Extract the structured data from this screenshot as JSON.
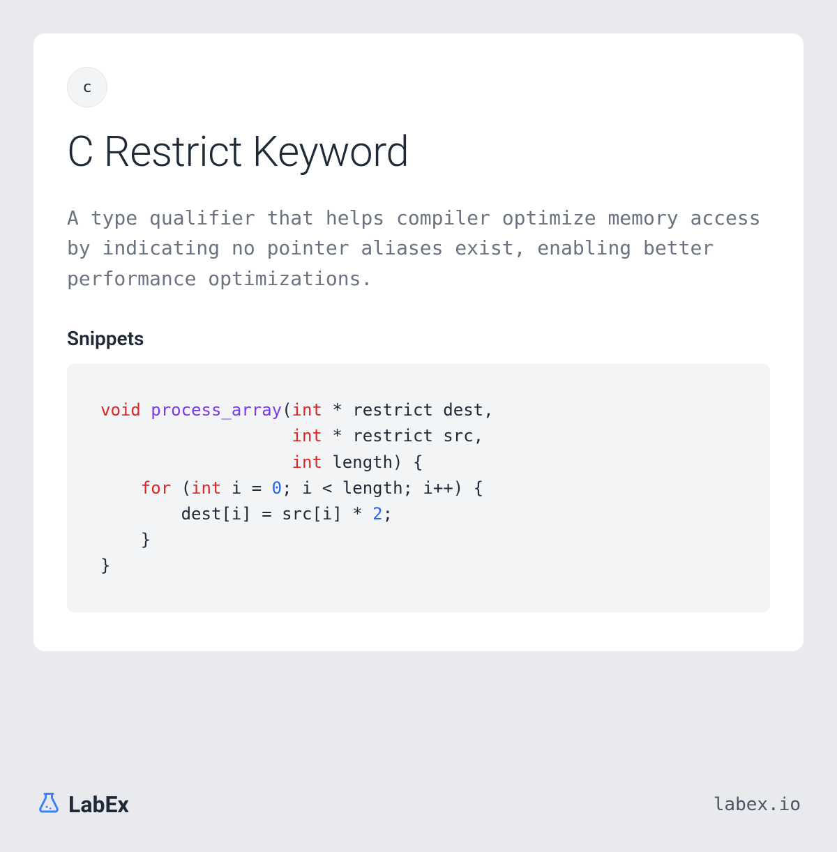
{
  "badge_letter": "c",
  "title": "C Restrict Keyword",
  "description": "A type qualifier that helps compiler optimize memory access by indicating no pointer aliases exist, enabling better performance optimizations.",
  "snippets_heading": "Snippets",
  "code": {
    "tokens": [
      {
        "t": "void",
        "c": "kw-type"
      },
      {
        "t": " "
      },
      {
        "t": "process_array",
        "c": "kw-fn"
      },
      {
        "t": "("
      },
      {
        "t": "int",
        "c": "kw-type"
      },
      {
        "t": " * restrict dest,\n                   "
      },
      {
        "t": "int",
        "c": "kw-type"
      },
      {
        "t": " * restrict src,\n                   "
      },
      {
        "t": "int",
        "c": "kw-type"
      },
      {
        "t": " length) {\n    "
      },
      {
        "t": "for",
        "c": "kw-ctrl"
      },
      {
        "t": " ("
      },
      {
        "t": "int",
        "c": "kw-type"
      },
      {
        "t": " i = "
      },
      {
        "t": "0",
        "c": "kw-num"
      },
      {
        "t": "; i < length; i++) {\n        dest[i] = src[i] * "
      },
      {
        "t": "2",
        "c": "kw-num"
      },
      {
        "t": ";\n    }\n}"
      }
    ]
  },
  "brand_text": "LabEx",
  "site": "labex.io"
}
